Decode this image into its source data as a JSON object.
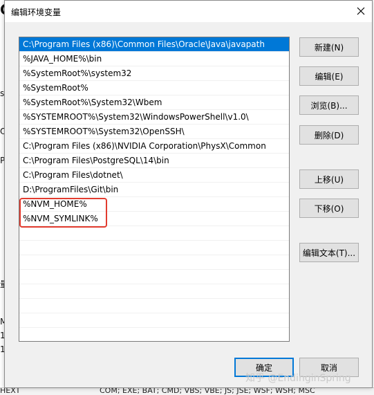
{
  "dialog": {
    "title": "编辑环境变量",
    "paths": [
      "C:\\Program Files (x86)\\Common Files\\Oracle\\Java\\javapath",
      "%JAVA_HOME%\\bin",
      "%SystemRoot%\\system32",
      "%SystemRoot%",
      "%SystemRoot%\\System32\\Wbem",
      "%SYSTEMROOT%\\System32\\WindowsPowerShell\\v1.0\\",
      "%SYSTEMROOT%\\System32\\OpenSSH\\",
      "C:\\Program Files (x86)\\NVIDIA Corporation\\PhysX\\Common",
      "C:\\Program Files\\PostgreSQL\\14\\bin",
      "C:\\Program Files\\dotnet\\",
      "D:\\ProgramFiles\\Git\\bin",
      "%NVM_HOME%",
      "%NVM_SYMLINK%"
    ],
    "selected_index": 0,
    "buttons": {
      "new": "新建(N)",
      "edit": "编辑(E)",
      "browse": "浏览(B)...",
      "delete": "删除(D)",
      "move_up": "上移(U)",
      "move_down": "下移(O)",
      "edit_text": "编辑文本(T)...",
      "ok": "确定",
      "cancel": "取消"
    },
    "accent_color": "#0078d7",
    "highlight_color": "#e23b2e"
  },
  "background": {
    "bottom_text": "COM; EXE; BAT; CMD; VBS; VBE; JS; JSE; WSF; WSH; MSC",
    "left_fragments": [
      "C",
      "s",
      "O",
      "P",
      "量",
      "ME",
      "1",
      "1",
      "HEXT"
    ]
  },
  "watermark": "知乎 @EndinginSpring"
}
